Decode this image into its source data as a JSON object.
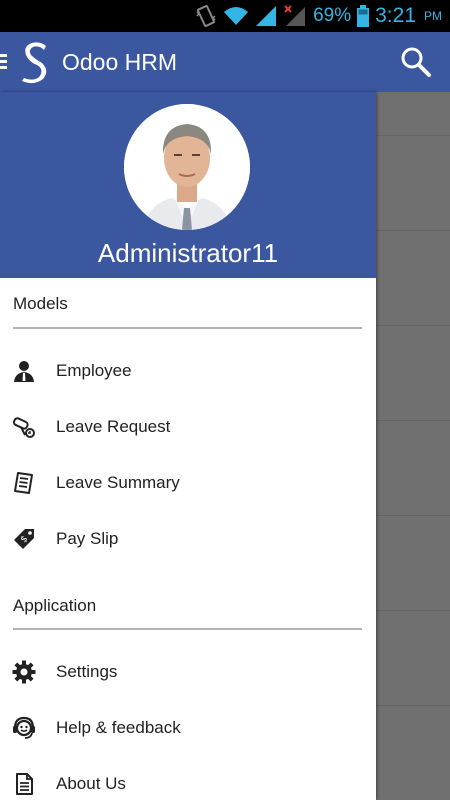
{
  "status_bar": {
    "battery": "69%",
    "time": "3:21",
    "ampm": "PM"
  },
  "app_bar": {
    "title": "Odoo HRM",
    "menu_icon": "hamburger-icon",
    "logo_icon": "s-logo-icon",
    "search_icon": "search-icon"
  },
  "drawer": {
    "user_name": "Administrator11",
    "sections": [
      {
        "title": "Models",
        "items": [
          {
            "label": "Employee",
            "icon": "employee-icon"
          },
          {
            "label": "Leave Request",
            "icon": "leave-request-icon"
          },
          {
            "label": "Leave Summary",
            "icon": "leave-summary-icon"
          },
          {
            "label": "Pay Slip",
            "icon": "pay-slip-icon"
          }
        ]
      },
      {
        "title": "Application",
        "items": [
          {
            "label": "Settings",
            "icon": "gear-icon"
          },
          {
            "label": "Help & feedback",
            "icon": "help-icon"
          },
          {
            "label": "About Us",
            "icon": "document-icon"
          }
        ]
      }
    ]
  },
  "colors": {
    "primary": "#3b57a0",
    "status_accent": "#33b5e5",
    "scrim": "#707070"
  }
}
